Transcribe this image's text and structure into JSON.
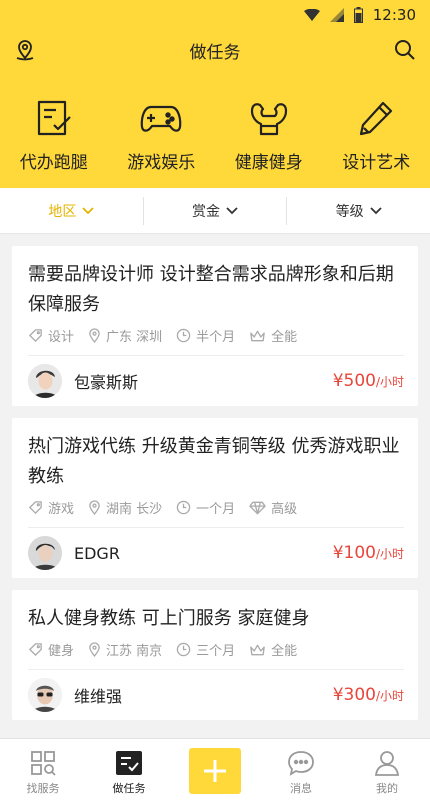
{
  "status_bar": {
    "time": "12:30"
  },
  "header": {
    "title": "做任务",
    "location_icon": "location-pin-icon",
    "search_icon": "search-icon"
  },
  "categories": [
    {
      "label": "代办跑腿",
      "icon": "checklist-icon"
    },
    {
      "label": "游戏娱乐",
      "icon": "gamepad-icon"
    },
    {
      "label": "健康健身",
      "icon": "muscle-icon"
    },
    {
      "label": "设计艺术",
      "icon": "pencil-icon"
    }
  ],
  "filters": [
    {
      "label": "地区",
      "active": true
    },
    {
      "label": "赏金",
      "active": false
    },
    {
      "label": "等级",
      "active": false
    }
  ],
  "tasks": [
    {
      "title": "需要品牌设计师 设计整合需求品牌形象和后期保障服务",
      "category": "设计",
      "location": "广东 深圳",
      "duration": "半个月",
      "level": "全能",
      "user": "包豪斯斯",
      "price": "¥500",
      "unit": "/小时"
    },
    {
      "title": "热门游戏代练 升级黄金青铜等级 优秀游戏职业教练",
      "category": "游戏",
      "location": "湖南 长沙",
      "duration": "一个月",
      "level": "高级",
      "user": "EDGR",
      "price": "¥100",
      "unit": "/小时"
    },
    {
      "title": "私人健身教练 可上门服务 家庭健身",
      "category": "健身",
      "location": "江苏 南京",
      "duration": "三个月",
      "level": "全能",
      "user": "维维强",
      "price": "¥300",
      "unit": "/小时"
    }
  ],
  "tab_bar": [
    {
      "label": "找服务",
      "icon": "grid-search-icon",
      "active": false
    },
    {
      "label": "做任务",
      "icon": "task-list-icon",
      "active": true
    },
    {
      "label": "",
      "icon": "plus-icon",
      "active": false
    },
    {
      "label": "消息",
      "icon": "chat-bubble-icon",
      "active": false
    },
    {
      "label": "我的",
      "icon": "person-icon",
      "active": false
    }
  ],
  "colors": {
    "brand": "#ffd83a",
    "price": "#e8463a",
    "active_filter": "#e6b400"
  }
}
